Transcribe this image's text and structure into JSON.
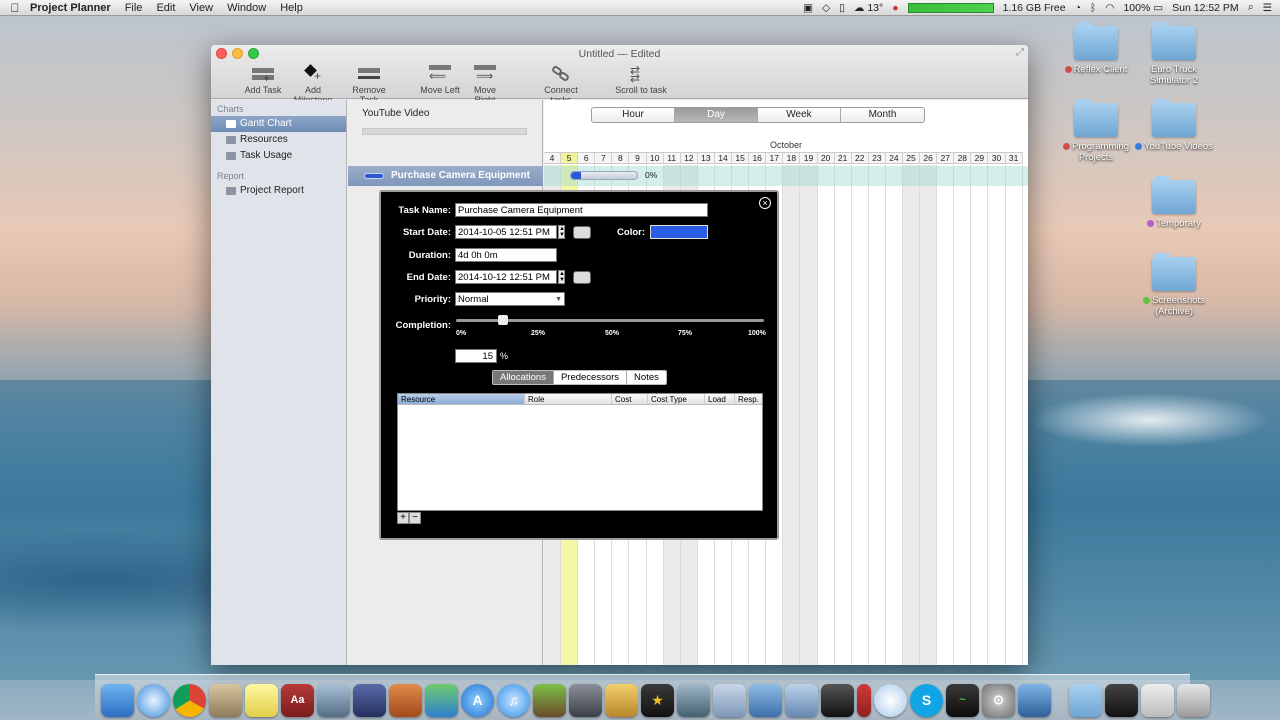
{
  "menubar": {
    "app_name": "Project Planner",
    "menus": [
      "File",
      "Edit",
      "View",
      "Window",
      "Help"
    ],
    "weather": "13°",
    "memory": "1.16 GB Free",
    "battery": "100%",
    "clock": "Sun 12:52 PM"
  },
  "desktop_icons": [
    {
      "label": "Reflex Client",
      "tag_color": "#d24d4d"
    },
    {
      "label": "Euro Truck Simulator 2",
      "tag_color": ""
    },
    {
      "label": "Programming Projects",
      "tag_color": "#d24d4d"
    },
    {
      "label": "YouTube Videos",
      "tag_color": "#3b7bd8"
    },
    {
      "label": "Temporary",
      "tag_color": "#b35fd0"
    },
    {
      "label": "Screenshots (Archive)",
      "tag_color": "#57c43c"
    }
  ],
  "window": {
    "title": "Untitled — Edited",
    "toolbar": {
      "add_task": "Add Task",
      "add_milestone": "Add Milestone",
      "remove_task": "Remove Task",
      "move_left": "Move Left",
      "move_right": "Move Right",
      "connect_tasks": "Connect tasks",
      "scroll_to_task": "Scroll to task"
    }
  },
  "sidebar": {
    "charts_header": "Charts",
    "items": [
      "Gantt Chart",
      "Resources",
      "Task Usage"
    ],
    "report_header": "Report",
    "report_items": [
      "Project Report"
    ]
  },
  "taskpane": {
    "project_title": "YouTube Video",
    "task_name": "Purchase Camera Equipment"
  },
  "gantt": {
    "scale_options": [
      "Hour",
      "Day",
      "Week",
      "Month"
    ],
    "selected_scale": "Day",
    "month": "October",
    "days": [
      "4",
      "5",
      "6",
      "7",
      "8",
      "9",
      "10",
      "11",
      "12",
      "13",
      "14",
      "15",
      "16",
      "17",
      "18",
      "19",
      "20",
      "21",
      "22",
      "23",
      "24",
      "25",
      "26",
      "27",
      "28",
      "29",
      "30",
      "31"
    ],
    "task_percent": "0%"
  },
  "popover": {
    "task_name_label": "Task Name:",
    "task_name": "Purchase Camera Equipment",
    "start_date_label": "Start Date:",
    "start_date": "2014-10-05 12:51 PM",
    "color_label": "Color:",
    "color": "#2a5ee8",
    "duration_label": "Duration:",
    "duration": "4d 0h 0m",
    "end_date_label": "End Date:",
    "end_date": "2014-10-12 12:51 PM",
    "priority_label": "Priority:",
    "priority": "Normal",
    "completion_label": "Completion:",
    "completion_value": 15,
    "completion_text": "15",
    "percent_sign": "%",
    "ticks": [
      "0%",
      "25%",
      "50%",
      "75%",
      "100%"
    ],
    "tabs": [
      "Allocations",
      "Predecessors",
      "Notes"
    ],
    "selected_tab": "Allocations",
    "columns": [
      "Resource",
      "Role",
      "Cost",
      "Cost Type",
      "Load",
      "Resp."
    ],
    "add": "+",
    "remove": "−"
  }
}
